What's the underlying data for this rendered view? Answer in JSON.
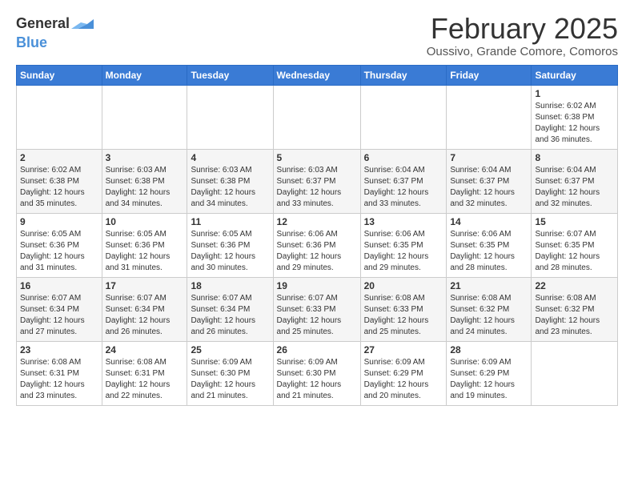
{
  "logo": {
    "text_general": "General",
    "text_blue": "Blue"
  },
  "header": {
    "title": "February 2025",
    "subtitle": "Oussivo, Grande Comore, Comoros"
  },
  "weekdays": [
    "Sunday",
    "Monday",
    "Tuesday",
    "Wednesday",
    "Thursday",
    "Friday",
    "Saturday"
  ],
  "weeks": [
    [
      {
        "day": "",
        "info": ""
      },
      {
        "day": "",
        "info": ""
      },
      {
        "day": "",
        "info": ""
      },
      {
        "day": "",
        "info": ""
      },
      {
        "day": "",
        "info": ""
      },
      {
        "day": "",
        "info": ""
      },
      {
        "day": "1",
        "info": "Sunrise: 6:02 AM\nSunset: 6:38 PM\nDaylight: 12 hours\nand 36 minutes."
      }
    ],
    [
      {
        "day": "2",
        "info": "Sunrise: 6:02 AM\nSunset: 6:38 PM\nDaylight: 12 hours\nand 35 minutes."
      },
      {
        "day": "3",
        "info": "Sunrise: 6:03 AM\nSunset: 6:38 PM\nDaylight: 12 hours\nand 34 minutes."
      },
      {
        "day": "4",
        "info": "Sunrise: 6:03 AM\nSunset: 6:38 PM\nDaylight: 12 hours\nand 34 minutes."
      },
      {
        "day": "5",
        "info": "Sunrise: 6:03 AM\nSunset: 6:37 PM\nDaylight: 12 hours\nand 33 minutes."
      },
      {
        "day": "6",
        "info": "Sunrise: 6:04 AM\nSunset: 6:37 PM\nDaylight: 12 hours\nand 33 minutes."
      },
      {
        "day": "7",
        "info": "Sunrise: 6:04 AM\nSunset: 6:37 PM\nDaylight: 12 hours\nand 32 minutes."
      },
      {
        "day": "8",
        "info": "Sunrise: 6:04 AM\nSunset: 6:37 PM\nDaylight: 12 hours\nand 32 minutes."
      }
    ],
    [
      {
        "day": "9",
        "info": "Sunrise: 6:05 AM\nSunset: 6:36 PM\nDaylight: 12 hours\nand 31 minutes."
      },
      {
        "day": "10",
        "info": "Sunrise: 6:05 AM\nSunset: 6:36 PM\nDaylight: 12 hours\nand 31 minutes."
      },
      {
        "day": "11",
        "info": "Sunrise: 6:05 AM\nSunset: 6:36 PM\nDaylight: 12 hours\nand 30 minutes."
      },
      {
        "day": "12",
        "info": "Sunrise: 6:06 AM\nSunset: 6:36 PM\nDaylight: 12 hours\nand 29 minutes."
      },
      {
        "day": "13",
        "info": "Sunrise: 6:06 AM\nSunset: 6:35 PM\nDaylight: 12 hours\nand 29 minutes."
      },
      {
        "day": "14",
        "info": "Sunrise: 6:06 AM\nSunset: 6:35 PM\nDaylight: 12 hours\nand 28 minutes."
      },
      {
        "day": "15",
        "info": "Sunrise: 6:07 AM\nSunset: 6:35 PM\nDaylight: 12 hours\nand 28 minutes."
      }
    ],
    [
      {
        "day": "16",
        "info": "Sunrise: 6:07 AM\nSunset: 6:34 PM\nDaylight: 12 hours\nand 27 minutes."
      },
      {
        "day": "17",
        "info": "Sunrise: 6:07 AM\nSunset: 6:34 PM\nDaylight: 12 hours\nand 26 minutes."
      },
      {
        "day": "18",
        "info": "Sunrise: 6:07 AM\nSunset: 6:34 PM\nDaylight: 12 hours\nand 26 minutes."
      },
      {
        "day": "19",
        "info": "Sunrise: 6:07 AM\nSunset: 6:33 PM\nDaylight: 12 hours\nand 25 minutes."
      },
      {
        "day": "20",
        "info": "Sunrise: 6:08 AM\nSunset: 6:33 PM\nDaylight: 12 hours\nand 25 minutes."
      },
      {
        "day": "21",
        "info": "Sunrise: 6:08 AM\nSunset: 6:32 PM\nDaylight: 12 hours\nand 24 minutes."
      },
      {
        "day": "22",
        "info": "Sunrise: 6:08 AM\nSunset: 6:32 PM\nDaylight: 12 hours\nand 23 minutes."
      }
    ],
    [
      {
        "day": "23",
        "info": "Sunrise: 6:08 AM\nSunset: 6:31 PM\nDaylight: 12 hours\nand 23 minutes."
      },
      {
        "day": "24",
        "info": "Sunrise: 6:08 AM\nSunset: 6:31 PM\nDaylight: 12 hours\nand 22 minutes."
      },
      {
        "day": "25",
        "info": "Sunrise: 6:09 AM\nSunset: 6:30 PM\nDaylight: 12 hours\nand 21 minutes."
      },
      {
        "day": "26",
        "info": "Sunrise: 6:09 AM\nSunset: 6:30 PM\nDaylight: 12 hours\nand 21 minutes."
      },
      {
        "day": "27",
        "info": "Sunrise: 6:09 AM\nSunset: 6:29 PM\nDaylight: 12 hours\nand 20 minutes."
      },
      {
        "day": "28",
        "info": "Sunrise: 6:09 AM\nSunset: 6:29 PM\nDaylight: 12 hours\nand 19 minutes."
      },
      {
        "day": "",
        "info": ""
      }
    ]
  ]
}
